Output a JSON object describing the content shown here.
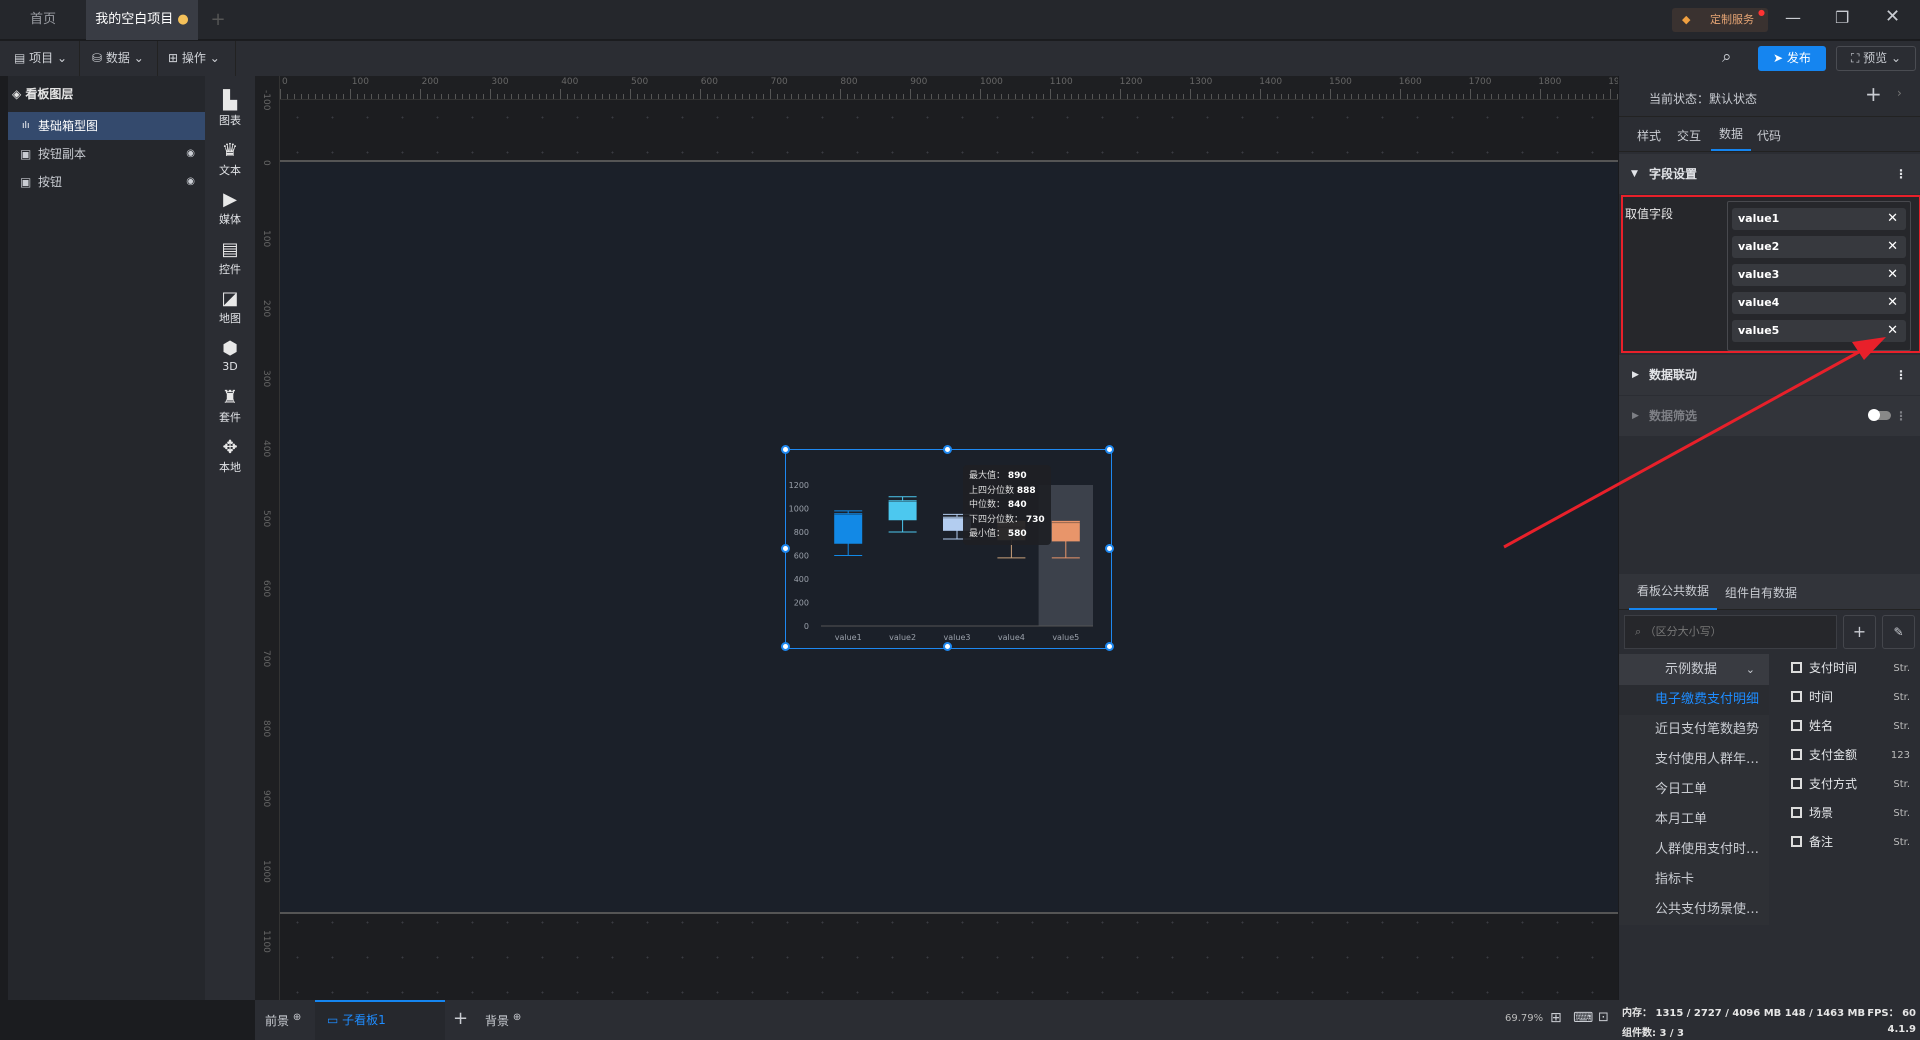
{
  "window": {
    "tabs": [
      {
        "label": "首页"
      },
      {
        "label": "我的空白项目",
        "modified": true
      }
    ],
    "custom_service": "定制服务"
  },
  "toolbar": {
    "menus": [
      {
        "label": "项目"
      },
      {
        "label": "数据"
      },
      {
        "label": "操作"
      }
    ],
    "publish": "发布",
    "preview": "预览"
  },
  "layers": {
    "title": "看板图层",
    "items": [
      {
        "label": "基础箱型图",
        "selected": true
      },
      {
        "label": "按钮副本"
      },
      {
        "label": "按钮"
      }
    ]
  },
  "components": [
    {
      "label": "图表",
      "icon": "bar-chart-icon"
    },
    {
      "label": "文本",
      "icon": "text-icon"
    },
    {
      "label": "媒体",
      "icon": "media-icon"
    },
    {
      "label": "控件",
      "icon": "control-icon"
    },
    {
      "label": "地图",
      "icon": "map-icon"
    },
    {
      "label": "3D",
      "icon": "cube-icon"
    },
    {
      "label": "套件",
      "icon": "kit-icon"
    },
    {
      "label": "本地",
      "icon": "puzzle-icon"
    }
  ],
  "chart_data": {
    "type": "boxplot",
    "categories": [
      "value1",
      "value2",
      "value3",
      "value4",
      "value5"
    ],
    "ylim": [
      0,
      1200
    ],
    "yticks": [
      0,
      200,
      400,
      600,
      800,
      1000,
      1200
    ],
    "series": [
      {
        "min": 600,
        "q1": 700,
        "median": 950,
        "q3": 960,
        "max": 980,
        "color": "#1289e6"
      },
      {
        "min": 800,
        "q1": 900,
        "median": 1060,
        "q3": 1070,
        "max": 1100,
        "color": "#4cc8ef"
      },
      {
        "min": 740,
        "q1": 810,
        "median": 920,
        "q3": 930,
        "max": 950,
        "color": "#b3cdf0"
      },
      {
        "min": 580,
        "q1": 730,
        "median": 840,
        "q3": 888,
        "max": 890,
        "color": "#c9a07a"
      },
      {
        "min": 580,
        "q1": 720,
        "median": 880,
        "q3": 890,
        "max": 890,
        "color": "#e8956a"
      }
    ],
    "highlight": "value5",
    "tooltip": {
      "rows": [
        {
          "label": "最大值：",
          "value": "890"
        },
        {
          "label": "上四分位数",
          "value": "888"
        },
        {
          "label": "中位数：",
          "value": "840"
        },
        {
          "label": "下四分位数：",
          "value": "730"
        },
        {
          "label": "最小值：",
          "value": "580"
        }
      ]
    }
  },
  "bottom": {
    "foreground": "前景",
    "subboard": "子看板1",
    "background": "背景",
    "zoom": "69.79%"
  },
  "right": {
    "state": "当前状态：默认状态",
    "tabs": [
      "样式",
      "交互",
      "数据",
      "代码"
    ],
    "active_tab": "数据",
    "field_section": "字段设置",
    "field_label": "取值字段",
    "fields": [
      "value1",
      "value2",
      "value3",
      "value4",
      "value5"
    ],
    "linkage": "数据联动",
    "filter": "数据筛选",
    "data_tabs": [
      "看板公共数据",
      "组件自有数据"
    ],
    "search_placeholder": "（区分大小写）",
    "dataset_group": "示例数据",
    "datasets": [
      "电子缴费支付明细",
      "近日支付笔数趋势",
      "支付使用人群年龄...",
      "今日工单",
      "本月工单",
      "人群使用支付时间...",
      "指标卡",
      "公共支付场景使用..."
    ],
    "columns": [
      {
        "name": "支付时间",
        "type": "Str."
      },
      {
        "name": "时间",
        "type": "Str."
      },
      {
        "name": "姓名",
        "type": "Str."
      },
      {
        "name": "支付金额",
        "type": "123"
      },
      {
        "name": "支付方式",
        "type": "Str."
      },
      {
        "name": "场景",
        "type": "Str."
      },
      {
        "name": "备注",
        "type": "Str."
      }
    ]
  },
  "status": {
    "memory": "内存：  1315 / 2727 / 4096 MB  148 / 1463 MB",
    "fps": "FPS：  60",
    "count": "组件数: 3 / 3",
    "version": "4.1.9"
  }
}
